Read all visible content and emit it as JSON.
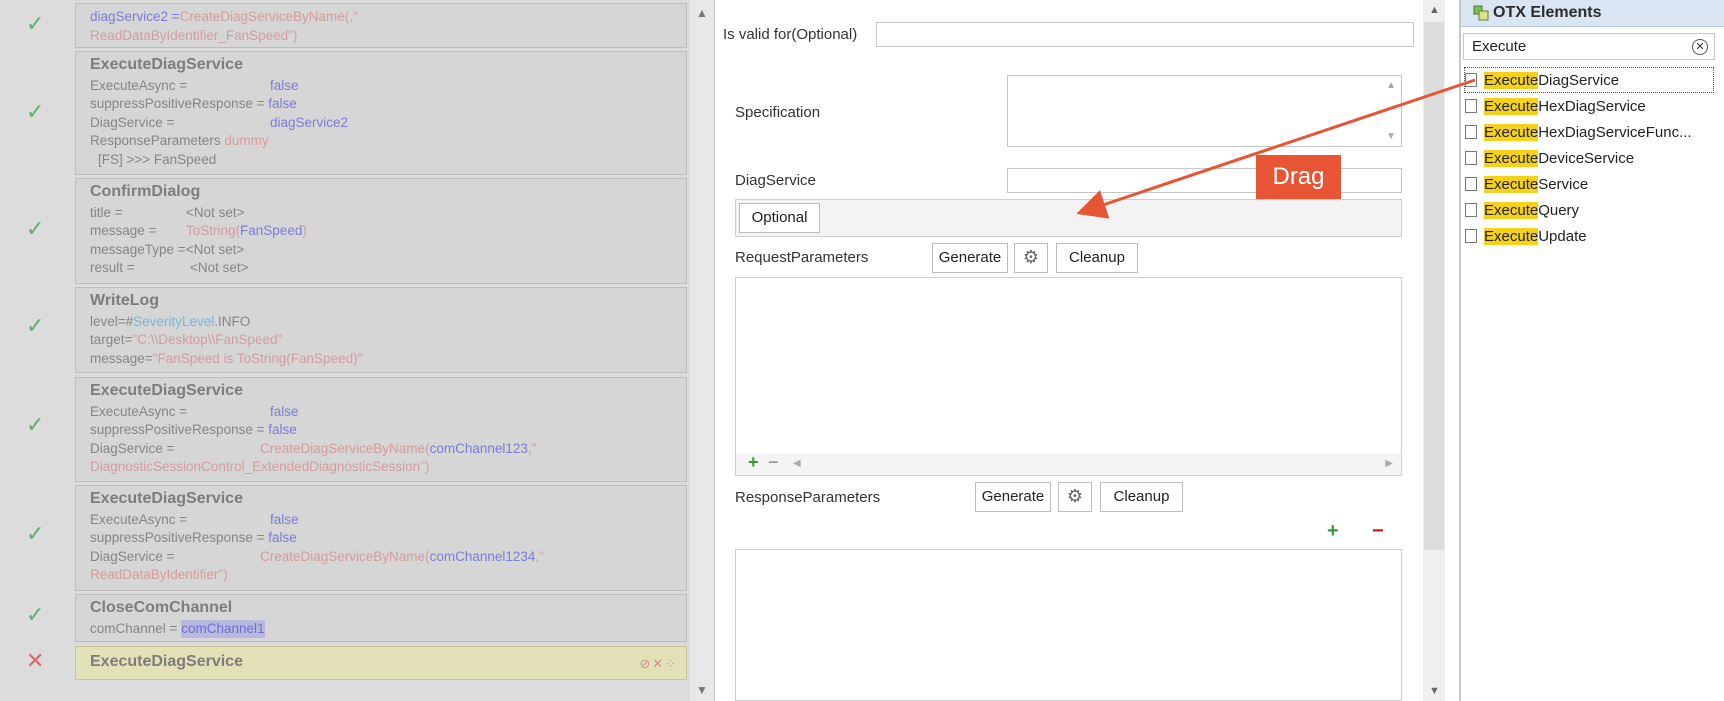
{
  "left": {
    "blocks": [
      {
        "status": "check",
        "prefix": "diagService2 = ",
        "call": "CreateDiagServiceByName(",
        "arg": ",\"",
        "line2": "ReadDataByIdentifier_FanSpeed\")"
      },
      {
        "status": "check",
        "title": "ExecuteDiagService",
        "rows": [
          [
            "ExecuteAsync =",
            "false"
          ],
          [
            "suppressPositiveResponse =",
            "false"
          ],
          [
            "DiagService =",
            "diagService2"
          ],
          [
            "ResponseParameters",
            "dummy"
          ],
          [
            "[FS]  >>> FanSpeed",
            ""
          ]
        ]
      },
      {
        "status": "check",
        "title": "ConfirmDialog",
        "rows": [
          [
            "title =",
            "<Not set>"
          ],
          [
            "message =",
            "ToString(",
            "FanSpeed",
            ")"
          ],
          [
            "messageType =",
            "<Not set>"
          ],
          [
            "result =",
            "<Not set>"
          ]
        ]
      },
      {
        "status": "check",
        "title": "WriteLog",
        "rows": [
          [
            "level=#",
            "SeverityLevel",
            ".INFO"
          ],
          [
            "target=",
            "\"C:\\\\Desktop\\\\FanSpeed\""
          ],
          [
            "message=",
            "\"FanSpeed is ToString(FanSpeed)\""
          ]
        ]
      },
      {
        "status": "check",
        "title": "ExecuteDiagService",
        "rows": [
          [
            "ExecuteAsync =",
            "false"
          ],
          [
            "suppressPositiveResponse =",
            "false"
          ],
          [
            "DiagService =",
            "CreateDiagServiceByName(",
            "comChannel123",
            ",\""
          ],
          [
            "DiagnosticSessionControl_ExtendedDiagnosticSession\")",
            ""
          ]
        ]
      },
      {
        "status": "check",
        "title": "ExecuteDiagService",
        "rows": [
          [
            "ExecuteAsync =",
            "false"
          ],
          [
            "suppressPositiveResponse =",
            "false"
          ],
          [
            "DiagService =",
            "CreateDiagServiceByName(",
            "comChannel1234",
            ",\""
          ],
          [
            "ReadDataByIdentifier\")",
            ""
          ]
        ]
      },
      {
        "status": "check",
        "title": "CloseComChannel",
        "rows": [
          [
            "comChannel =",
            "comChannel1"
          ]
        ]
      },
      {
        "status": "error",
        "title": "ExecuteDiagService",
        "icons": "⊘✕⁘"
      }
    ]
  },
  "mid": {
    "valid_for_label": "Is valid for(Optional)",
    "spec_label": "Specification",
    "diag_label": "DiagService",
    "optional_btn": "Optional",
    "req_label": "RequestParameters",
    "resp_label": "ResponseParameters",
    "generate": "Generate",
    "cleanup": "Cleanup",
    "plus": "+",
    "minus": "−"
  },
  "right": {
    "title": "OTX Elements",
    "search_value": "Execute",
    "highlight": "Execute",
    "items": [
      "DiagService",
      "HexDiagService",
      "HexDiagServiceFunc...",
      "DeviceService",
      "Service",
      "Query",
      "Update"
    ]
  },
  "annotation": {
    "label": "Drag"
  },
  "colors": {
    "accent": "#e85535",
    "highlight": "#f5d219",
    "header": "#d9e5f3"
  }
}
